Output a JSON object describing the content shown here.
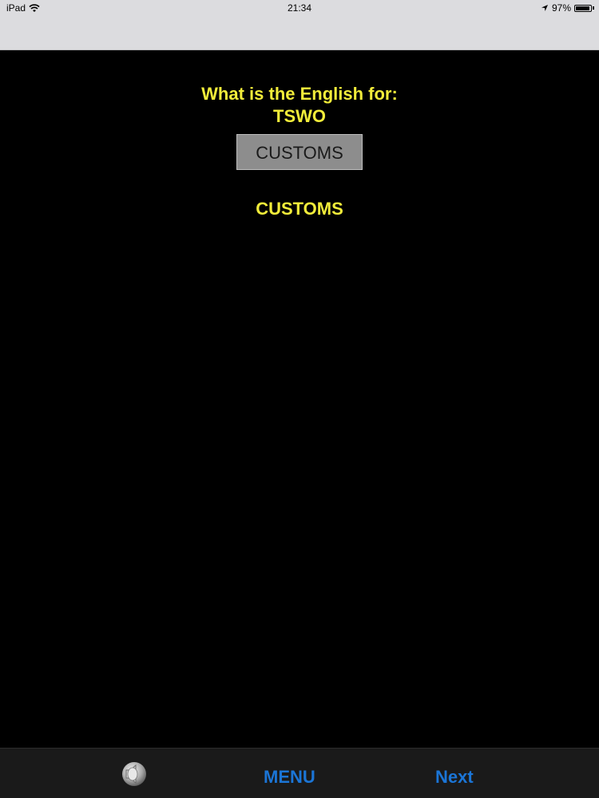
{
  "status_bar": {
    "device": "iPad",
    "time": "21:34",
    "battery": "97%",
    "battery_level": 0.97
  },
  "quiz": {
    "question": "What is the English for:",
    "word": "TSWO",
    "answer_value": "CUSTOMS",
    "result": "CUSTOMS"
  },
  "toolbar": {
    "menu_label": "MENU",
    "next_label": "Next",
    "sound_icon": "speaker-icon"
  },
  "colors": {
    "background": "#000000",
    "question_text": "#f1ec3a",
    "toolbar_button": "#1b75d6",
    "answer_box": "#8d8d8d"
  }
}
